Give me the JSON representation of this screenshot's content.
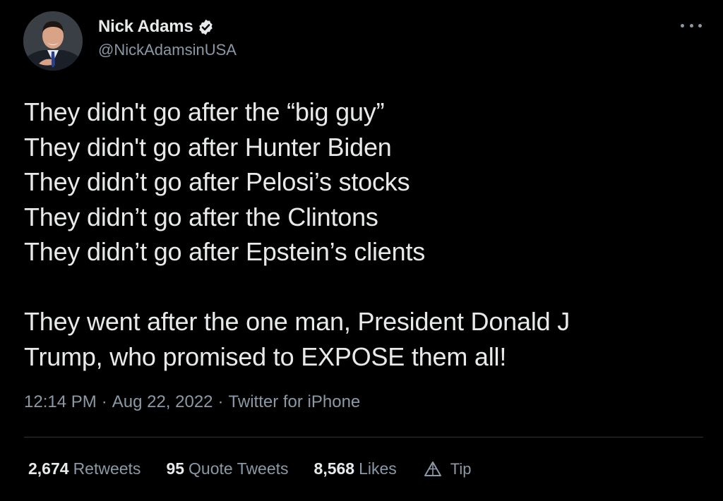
{
  "author": {
    "display_name": "Nick Adams",
    "handle": "@NickAdamsinUSA",
    "verified_icon": "verified-badge-icon",
    "avatar_icon": "profile-photo"
  },
  "tweet": {
    "lines": [
      "They didn't go after the “big guy”",
      "They didn't go after Hunter Biden",
      "They didn’t go after Pelosi’s stocks",
      "They didn’t go after the Clintons",
      "They didn’t go after Epstein’s clients"
    ],
    "closing_lines": [
      "They went after the one man, President Donald J",
      "Trump, who promised to EXPOSE them all!"
    ]
  },
  "meta": {
    "time": "12:14 PM",
    "date": "Aug 22, 2022",
    "source": "Twitter for iPhone",
    "separator": "·"
  },
  "stats": {
    "retweets_count": "2,674",
    "retweets_label": "Retweets",
    "quote_tweets_count": "95",
    "quote_tweets_label": "Quote Tweets",
    "likes_count": "8,568",
    "likes_label": "Likes",
    "tip_label": "Tip"
  },
  "colors": {
    "background": "#000000",
    "primary_text": "#e7e9ea",
    "secondary_text": "#8b98a5",
    "divider": "#2f3336"
  }
}
